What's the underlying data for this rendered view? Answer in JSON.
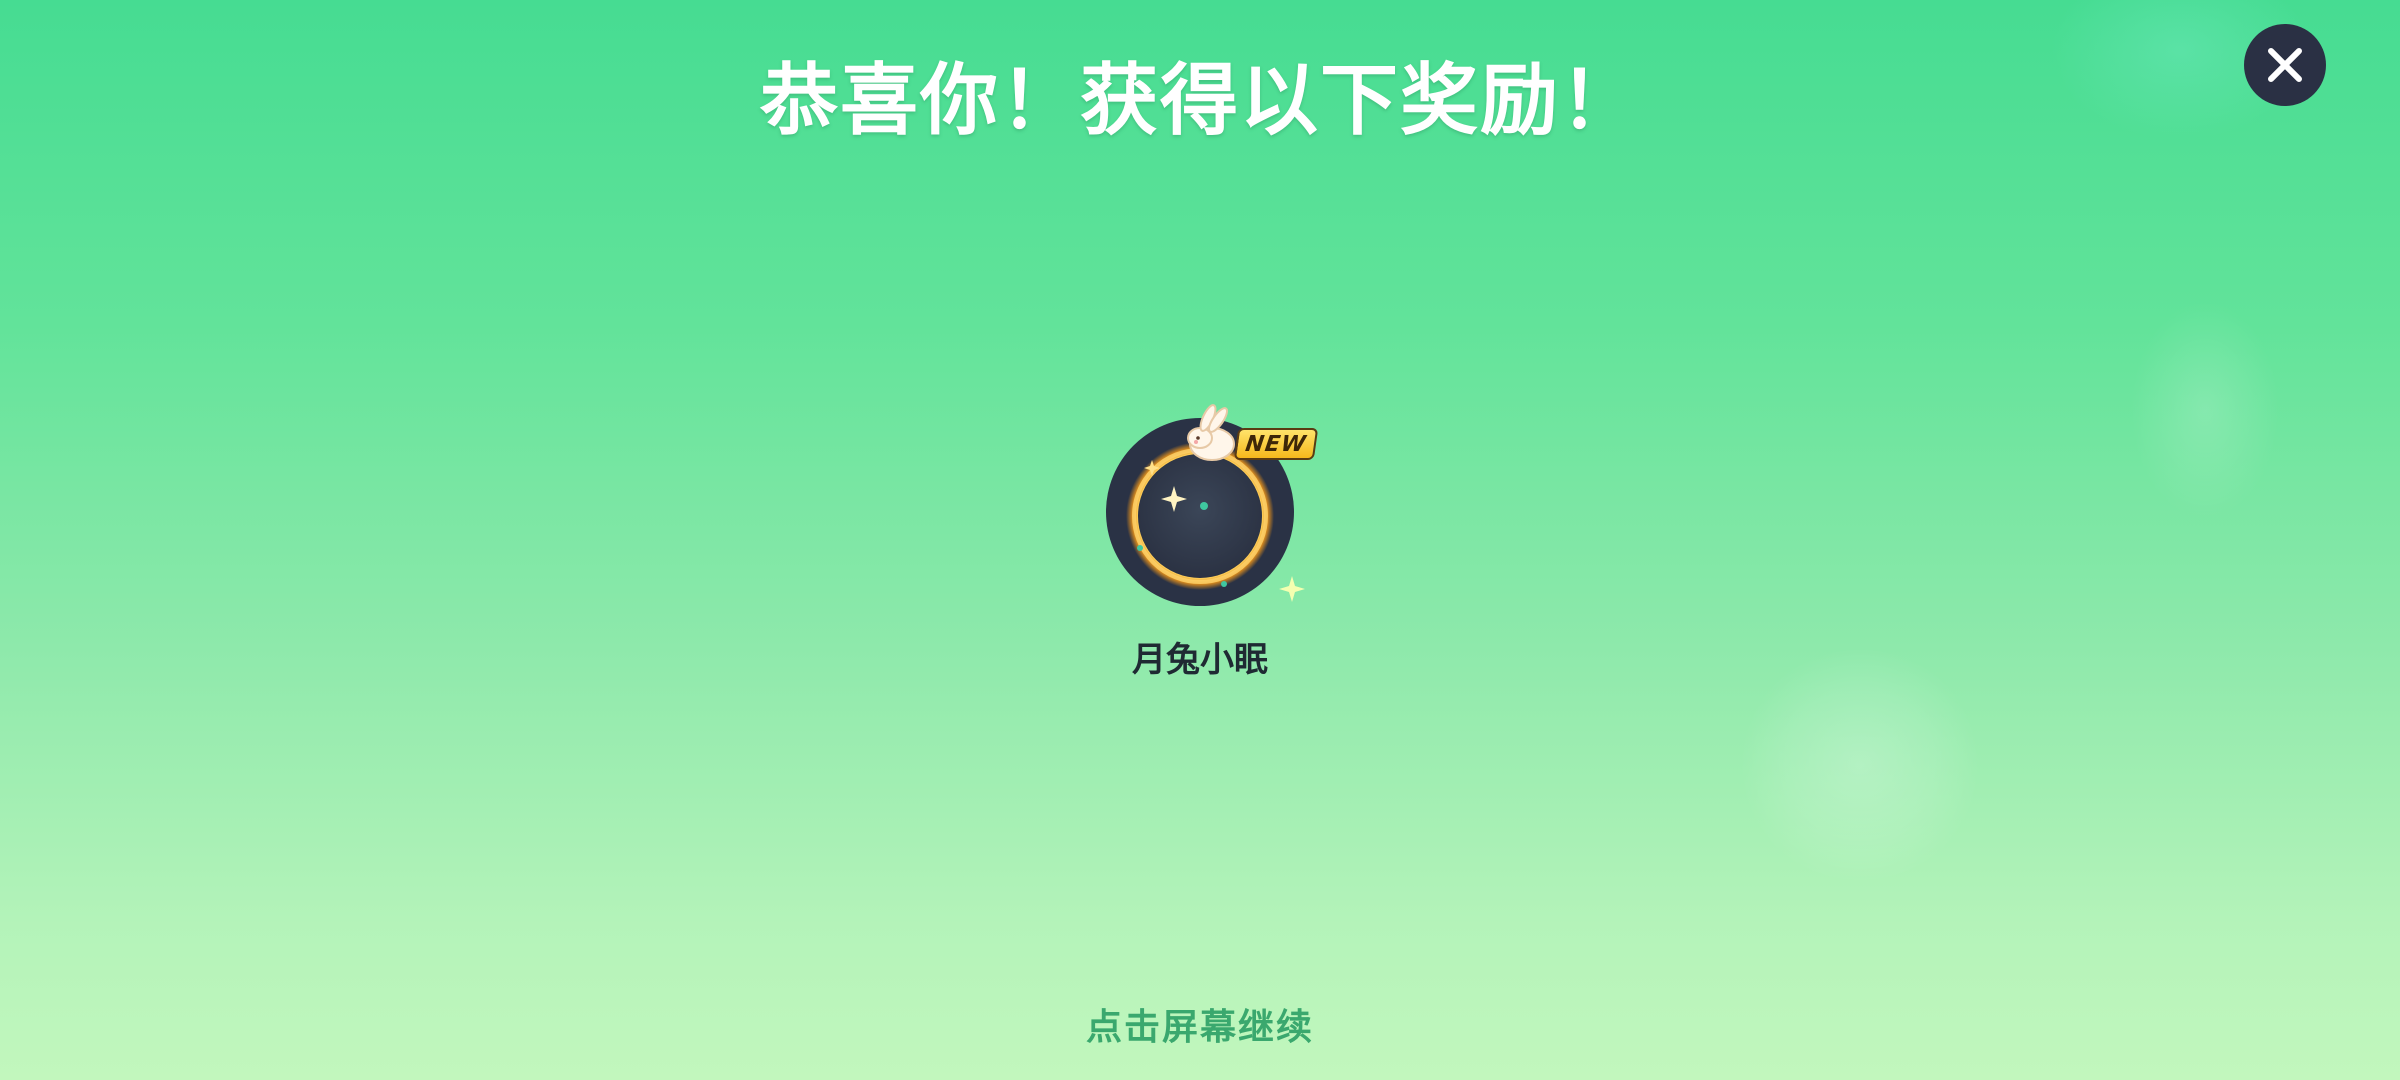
{
  "title": "恭喜你！获得以下奖励！",
  "close_icon": "close-icon",
  "reward": {
    "name": "月兔小眠",
    "badge": "NEW",
    "icon": "moon-rabbit-avatar-frame-icon"
  },
  "hint": "点击屏幕继续",
  "colors": {
    "background_top": "#46dc92",
    "background_bottom": "#c2f7bd",
    "close_button": "#2a3044",
    "hint_text": "#3aa86e",
    "badge": "#f6b81c"
  }
}
